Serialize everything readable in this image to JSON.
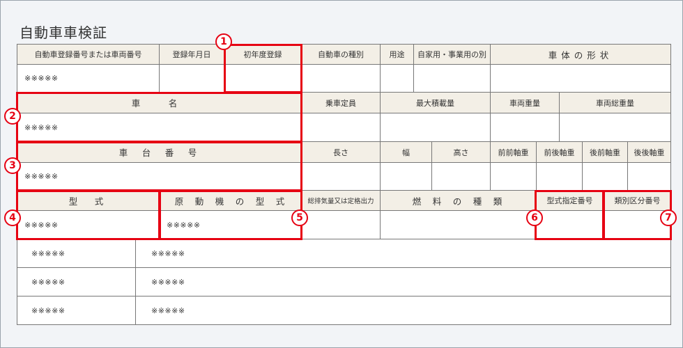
{
  "document": {
    "title": "自動車車検証"
  },
  "labels": {
    "reg_number": "自動車登録番号または車両番号",
    "reg_date": "登録年月日",
    "first_reg": "初年度登録",
    "vehicle_class": "自動車の種別",
    "usage": "用途",
    "private_business": "自家用・事業用の別",
    "body_shape": "車体の形状",
    "car_name": "車　名",
    "capacity": "乗車定員",
    "max_load": "最大積載量",
    "vehicle_weight": "車両重量",
    "gross_weight": "車両総重量",
    "chassis_number": "車　台　番　号",
    "length": "長さ",
    "width": "幅",
    "height": "高さ",
    "ff_axle": "前前軸重",
    "fr_axle": "前後軸重",
    "rf_axle": "後前軸重",
    "rr_axle": "後後軸重",
    "model": "型　式",
    "engine_model": "原　動　機　の　型　式",
    "displacement": "総排気量又は定格出力",
    "fuel": "燃　料　の　種　類",
    "model_designation": "型式指定番号",
    "category_number": "類別区分番号"
  },
  "values": {
    "reg_number": "※※※※※",
    "car_name": "※※※※※",
    "chassis_number": "※※※※※",
    "model": "※※※※※",
    "engine_model": "※※※※※",
    "bottom_rows": [
      [
        "※※※※※",
        "※※※※※"
      ],
      [
        "※※※※※",
        "※※※※※"
      ],
      [
        "※※※※※",
        "※※※※※"
      ]
    ]
  },
  "badges": [
    "1",
    "2",
    "3",
    "4",
    "5",
    "6",
    "7"
  ],
  "colors": {
    "highlight": "#e60012",
    "header_bg": "#f3efe6",
    "border": "#777777"
  }
}
